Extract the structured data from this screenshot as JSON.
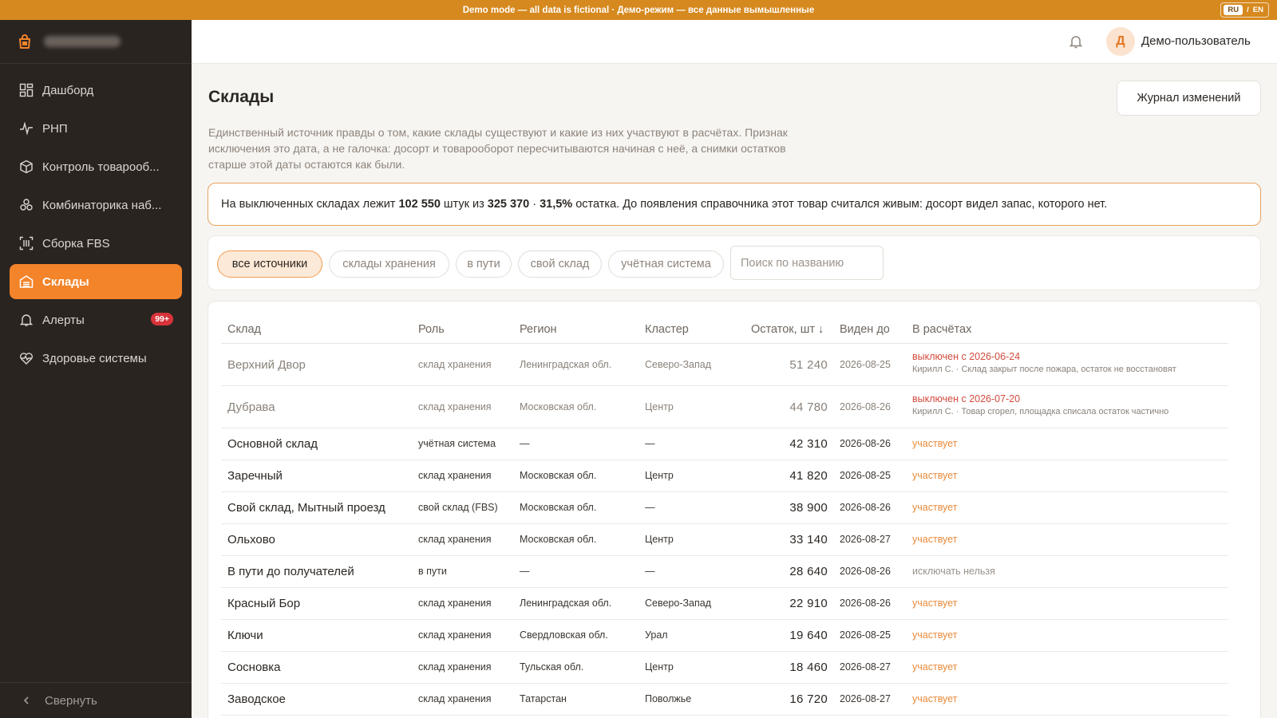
{
  "banner": {
    "text": "Demo mode — all data is fictional · Демо-режим — все данные вымышленные",
    "lang_ru": "RU",
    "lang_sep": "/",
    "lang_en": "EN"
  },
  "colors": {
    "accent": "#f3842a",
    "sidebar_bg": "#2a2421",
    "banner_bg": "#d6891e",
    "excluded": "#d24b3d"
  },
  "sidebar": {
    "brand_icon": "shopping-bag-icon",
    "items": [
      {
        "label": "Дашборд",
        "icon": "dashboard-grid-icon"
      },
      {
        "label": "РНП",
        "icon": "pulse-line-icon"
      },
      {
        "label": "Контроль товарооб...",
        "icon": "box-icon"
      },
      {
        "label": "Комбинаторика наб...",
        "icon": "molecule-icon"
      },
      {
        "label": "Сборка FBS",
        "icon": "barcode-icon"
      },
      {
        "label": "Склады",
        "icon": "warehouse-icon",
        "active": true
      },
      {
        "label": "Алерты",
        "icon": "bell-icon",
        "badge": "99+"
      },
      {
        "label": "Здоровье системы",
        "icon": "heart-pulse-icon"
      }
    ],
    "collapse_label": "Свернуть"
  },
  "topbar": {
    "avatar_initial": "Д",
    "user_name": "Демо-пользователь"
  },
  "page": {
    "title": "Склады",
    "changelog_button": "Журнал изменений",
    "description": "Единственный источник правды о том, какие склады существуют и какие из них участвуют в расчётах. Признак исключения это дата, а не галочка: досорт и товарооборот пересчитываются начиная с неё, а снимки остатков старше этой даты остаются как были.",
    "callout": {
      "prefix": "На выключенных складах лежит ",
      "excluded_qty": "102 550",
      "mid": " штук из ",
      "total_qty": "325 370",
      "sep": " · ",
      "percent": "31,5%",
      "suffix": " остатка. До появления справочника этот товар считался живым: досорт видел запас, которого нет."
    }
  },
  "filters": {
    "chips": [
      "все источники",
      "склады хранения",
      "в пути",
      "свой склад",
      "учётная система"
    ],
    "active_chip": "все источники",
    "search_placeholder": "Поиск по названию"
  },
  "table": {
    "columns": [
      "Склад",
      "Роль",
      "Регион",
      "Кластер",
      "Остаток, шт ↓",
      "Виден до",
      "В расчётах"
    ],
    "rows": [
      {
        "name": "Верхний Двор",
        "role": "склад хранения",
        "region": "Ленинградская обл.",
        "cluster": "Северо-Запад",
        "stock": "51 240",
        "seen": "2026-08-25",
        "status": "выключен с 2026-06-24",
        "status_type": "off",
        "note": "Кирилл С. · Склад закрыт после пожара, остаток не восстановят"
      },
      {
        "name": "Дубрава",
        "role": "склад хранения",
        "region": "Московская обл.",
        "cluster": "Центр",
        "stock": "44 780",
        "seen": "2026-08-26",
        "status": "выключен с 2026-07-20",
        "status_type": "off",
        "note": "Кирилл С. · Товар сгорел, площадка списала остаток частично"
      },
      {
        "name": "Основной склад",
        "role": "учётная система",
        "region": "—",
        "cluster": "—",
        "stock": "42 310",
        "seen": "2026-08-26",
        "status": "участвует",
        "status_type": "on"
      },
      {
        "name": "Заречный",
        "role": "склад хранения",
        "region": "Московская обл.",
        "cluster": "Центр",
        "stock": "41 820",
        "seen": "2026-08-25",
        "status": "участвует",
        "status_type": "on"
      },
      {
        "name": "Свой склад, Мытный проезд",
        "role": "свой склад (FBS)",
        "region": "Московская обл.",
        "cluster": "—",
        "stock": "38 900",
        "seen": "2026-08-26",
        "status": "участвует",
        "status_type": "on"
      },
      {
        "name": "Ольхово",
        "role": "склад хранения",
        "region": "Московская обл.",
        "cluster": "Центр",
        "stock": "33 140",
        "seen": "2026-08-27",
        "status": "участвует",
        "status_type": "on"
      },
      {
        "name": "В пути до получателей",
        "role": "в пути",
        "region": "—",
        "cluster": "—",
        "stock": "28 640",
        "seen": "2026-08-26",
        "status": "исключать нельзя",
        "status_type": "locked"
      },
      {
        "name": "Красный Бор",
        "role": "склад хранения",
        "region": "Ленинградская обл.",
        "cluster": "Северо-Запад",
        "stock": "22 910",
        "seen": "2026-08-26",
        "status": "участвует",
        "status_type": "on"
      },
      {
        "name": "Ключи",
        "role": "склад хранения",
        "region": "Свердловская обл.",
        "cluster": "Урал",
        "stock": "19 640",
        "seen": "2026-08-25",
        "status": "участвует",
        "status_type": "on"
      },
      {
        "name": "Сосновка",
        "role": "склад хранения",
        "region": "Тульская обл.",
        "cluster": "Центр",
        "stock": "18 460",
        "seen": "2026-08-27",
        "status": "участвует",
        "status_type": "on"
      },
      {
        "name": "Заводское",
        "role": "склад хранения",
        "region": "Татарстан",
        "cluster": "Поволжье",
        "stock": "16 720",
        "seen": "2026-08-27",
        "status": "участвует",
        "status_type": "on"
      }
    ]
  }
}
